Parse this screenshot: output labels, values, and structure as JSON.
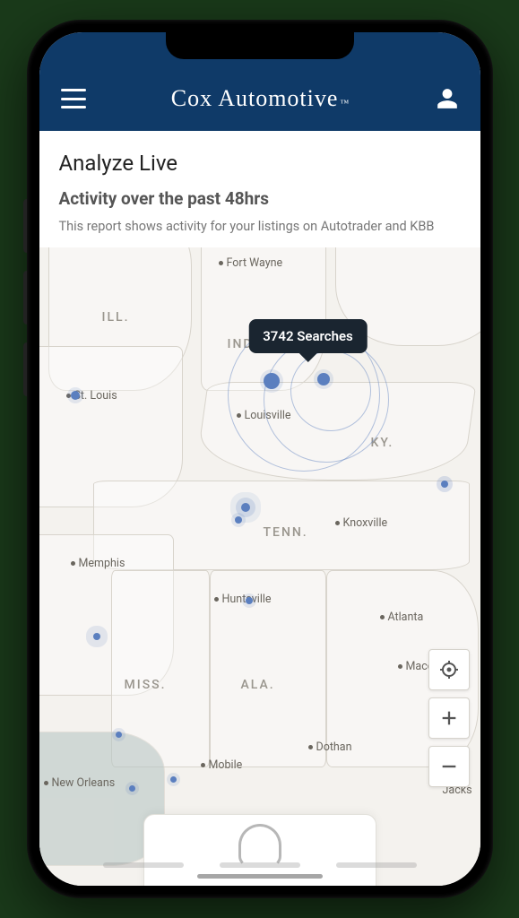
{
  "header": {
    "brand": "Cox Automotive",
    "brand_tm": "™"
  },
  "page": {
    "title": "Analyze Live",
    "subtitle": "Activity over the past 48hrs",
    "description": "This report shows activity for your listings on Autotrader and KBB"
  },
  "tooltip": {
    "text": "3742 Searches"
  },
  "states": {
    "ill": "ILL.",
    "ind": "IND.",
    "ky": "KY.",
    "tenn": "TENN.",
    "miss": "MISS.",
    "ala": "ALA."
  },
  "cities": {
    "fort_wayne": "Fort Wayne",
    "st_louis": "St. Louis",
    "louisville": "Louisville",
    "knoxville": "Knoxville",
    "memphis": "Memphis",
    "huntsville": "Huntsville",
    "atlanta": "Atlanta",
    "macon": "Macon",
    "mobile": "Mobile",
    "dothan": "Dothan",
    "new_orleans": "New Orleans",
    "jacks": "Jacks"
  },
  "colors": {
    "brand": "#0f3a68",
    "tooltip_bg": "#1a2530",
    "activity": "#5b7fbf"
  }
}
